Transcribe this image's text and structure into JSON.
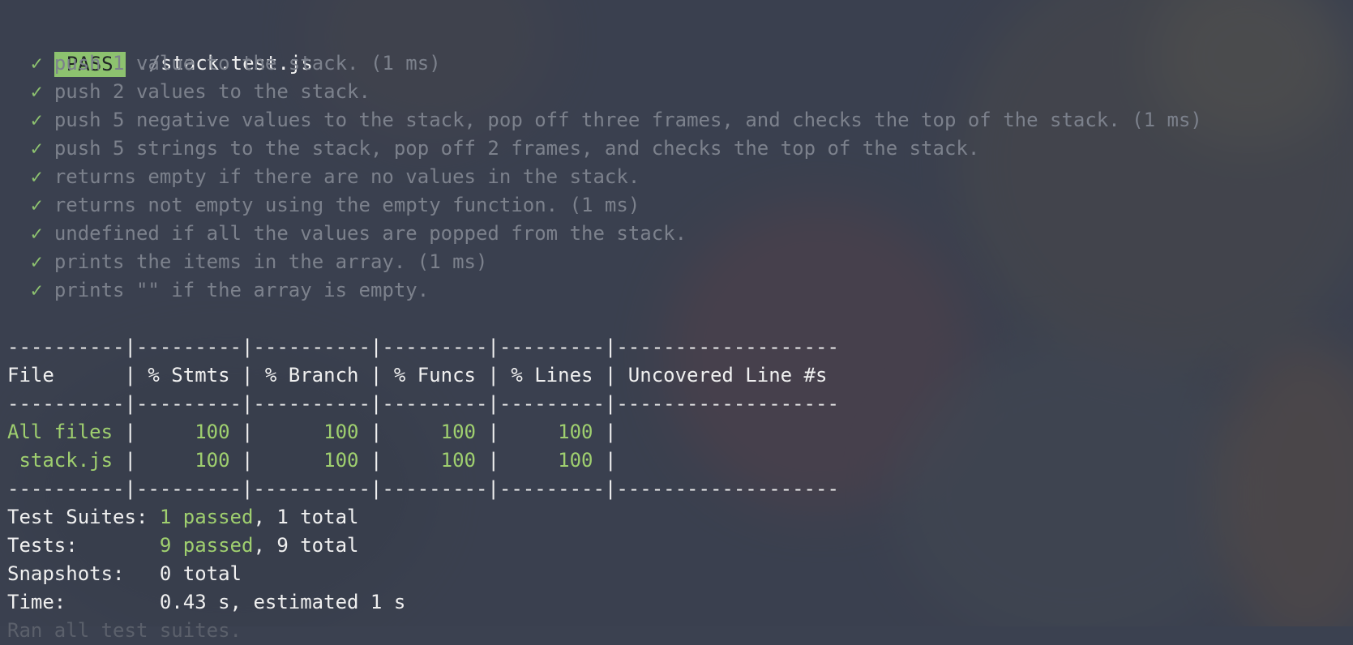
{
  "header": {
    "status": "PASS",
    "path_prefix": "./",
    "file": "stack.test.js"
  },
  "check_symbol": "✓",
  "tests": [
    "push 1 value to the stack. (1 ms)",
    "push 2 values to the stack.",
    "push 5 negative values to the stack, pop off three frames, and checks the top of the stack. (1 ms)",
    "push 5 strings to the stack, pop off 2 frames, and checks the top of the stack.",
    "returns empty if there are no values in the stack.",
    "returns not empty using the empty function. (1 ms)",
    "undefined if all the values are popped from the stack.",
    "prints the items in the array. (1 ms)",
    "prints \"\" if the array is empty."
  ],
  "coverage": {
    "separator": "----------|---------|----------|---------|---------|-------------------",
    "header": "File      | % Stmts | % Branch | % Funcs | % Lines | Uncovered Line #s",
    "rows": [
      {
        "file": "All files",
        "stmts": "100",
        "branch": "100",
        "funcs": "100",
        "lines": "100",
        "uncovered": ""
      },
      {
        "file": " stack.js",
        "stmts": "100",
        "branch": "100",
        "funcs": "100",
        "lines": "100",
        "uncovered": ""
      }
    ]
  },
  "summary": {
    "suites_label": "Test Suites: ",
    "suites_passed": "1 passed",
    "suites_total": ", 1 total",
    "tests_label": "Tests:       ",
    "tests_passed": "9 passed",
    "tests_total": ", 9 total",
    "snapshots_label": "Snapshots:   ",
    "snapshots_value": "0 total",
    "time_label": "Time:        ",
    "time_value": "0.43 s, estimated 1 s",
    "trailing": "Ran all test suites."
  },
  "colors": {
    "pass_badge": "#8dc26f",
    "check": "#8dc26f",
    "green_text": "#9fcf6f",
    "dim_text": "#7c818c"
  }
}
